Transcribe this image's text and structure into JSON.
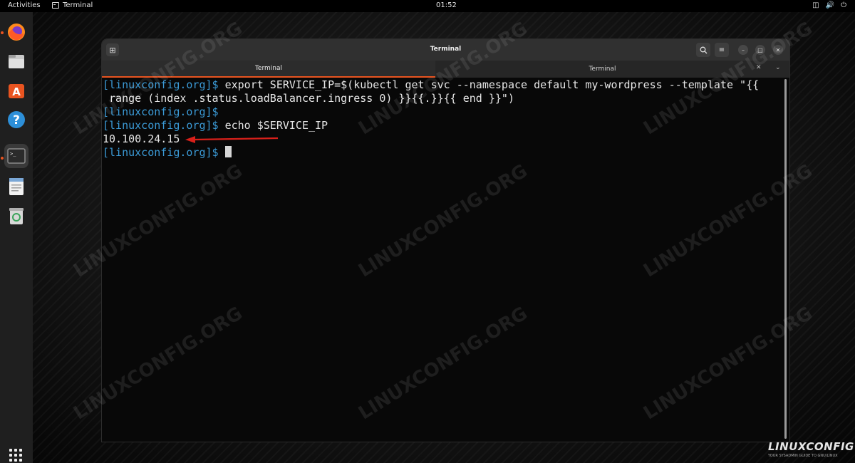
{
  "topbar": {
    "activities": "Activities",
    "app_name": "Terminal",
    "clock": "01:52",
    "tray_icons": [
      "network-icon",
      "volume-icon",
      "power-icon"
    ]
  },
  "dock": {
    "items": [
      "firefox-icon",
      "files-icon",
      "software-icon",
      "help-icon",
      "terminal-icon",
      "text-editor-icon",
      "trash-icon"
    ],
    "running": [
      "firefox-icon",
      "terminal-icon"
    ]
  },
  "window": {
    "title": "Terminal",
    "tabs": [
      {
        "label": "Terminal",
        "active": true
      },
      {
        "label": "Terminal",
        "active": false
      }
    ]
  },
  "terminal": {
    "prompt": "[linuxconfig.org]$",
    "lines": [
      {
        "prompt": "[linuxconfig.org]$",
        "text": " export SERVICE_IP=$(kubectl get svc --namespace default my-wordpress --template \"{{"
      },
      {
        "prompt": "",
        "text": " range (index .status.loadBalancer.ingress 0) }}{{.}}{{ end }}\")"
      },
      {
        "prompt": "[linuxconfig.org]$",
        "text": ""
      },
      {
        "prompt": "[linuxconfig.org]$",
        "text": " echo $SERVICE_IP"
      },
      {
        "prompt": "",
        "text": "10.100.24.15"
      },
      {
        "prompt": "[linuxconfig.org]$",
        "text": " "
      }
    ]
  },
  "watermark": "LINUXCONFIG.ORG",
  "logo": {
    "name": "LINUXCONFIG",
    "tagline": "YOUR SYSADMIN GUIDE TO GNU/LINUX"
  },
  "colors": {
    "accent": "#e95420",
    "prompt": "#3b9ad6",
    "annotation_arrow": "#d9201a"
  }
}
